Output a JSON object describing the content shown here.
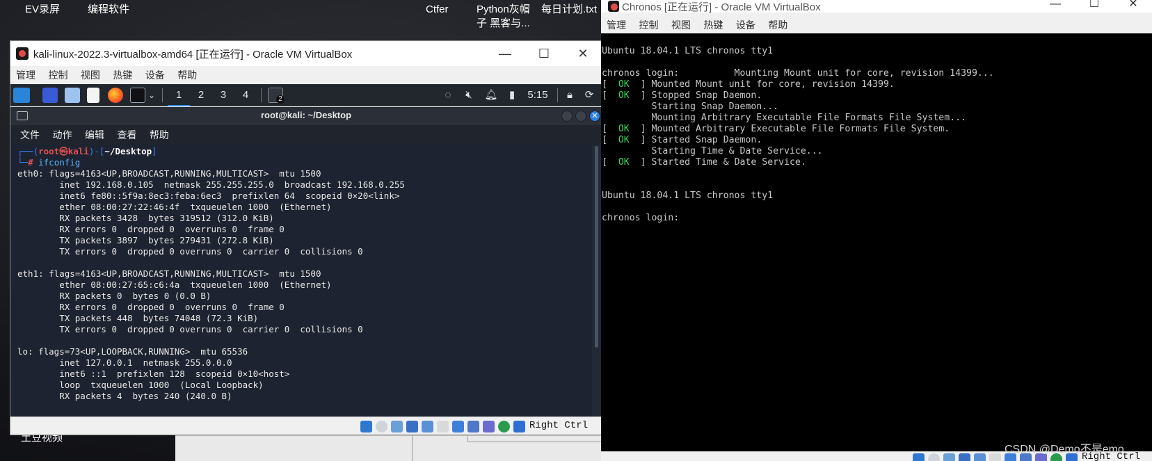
{
  "desktop": {
    "icons": [
      {
        "label": "EV录屏"
      },
      {
        "label": "编程软件"
      },
      {
        "label": "Ctfer"
      },
      {
        "label": "Python灰帽"
      },
      {
        "label": "子 黑客与..."
      },
      {
        "label": "每日计划.txt"
      },
      {
        "label": "土豆视频"
      }
    ],
    "watermark": "CSDN @Demo不是emo"
  },
  "kali_window": {
    "title": "kali-linux-2022.3-virtualbox-amd64 [正在运行] - Oracle VM VirtualBox",
    "menu": [
      "管理",
      "控制",
      "视图",
      "热键",
      "设备",
      "帮助"
    ],
    "panel": {
      "workspaces": [
        "1",
        "2",
        "3",
        "4"
      ],
      "terminal_badge": "2",
      "clock": "5:15"
    },
    "terminal": {
      "title": "root@kali: ~/Desktop",
      "menu": [
        "文件",
        "动作",
        "编辑",
        "查看",
        "帮助"
      ],
      "prompt": {
        "open": "┌──(",
        "user_host": "root㉿kali",
        "mid": ")-[",
        "path": "~/Desktop",
        "close": "]",
        "prefix": "└─",
        "hash": "# ",
        "command": "ifconfig"
      },
      "output": [
        "eth0: flags=4163<UP,BROADCAST,RUNNING,MULTICAST>  mtu 1500",
        "        inet 192.168.0.105  netmask 255.255.255.0  broadcast 192.168.0.255",
        "        inet6 fe80::5f9a:8ec3:feba:6ec3  prefixlen 64  scopeid 0×20<link>",
        "        ether 08:00:27:22:46:4f  txqueuelen 1000  (Ethernet)",
        "        RX packets 3428  bytes 319512 (312.0 KiB)",
        "        RX errors 0  dropped 0  overruns 0  frame 0",
        "        TX packets 3897  bytes 279431 (272.8 KiB)",
        "        TX errors 0  dropped 0 overruns 0  carrier 0  collisions 0",
        "",
        "eth1: flags=4163<UP,BROADCAST,RUNNING,MULTICAST>  mtu 1500",
        "        ether 08:00:27:65:c6:4a  txqueuelen 1000  (Ethernet)",
        "        RX packets 0  bytes 0 (0.0 B)",
        "        RX errors 0  dropped 0  overruns 0  frame 0",
        "        TX packets 448  bytes 74048 (72.3 KiB)",
        "        TX errors 0  dropped 0 overruns 0  carrier 0  collisions 0",
        "",
        "lo: flags=73<UP,LOOPBACK,RUNNING>  mtu 65536",
        "        inet 127.0.0.1  netmask 255.0.0.0",
        "        inet6 ::1  prefixlen 128  scopeid 0×10<host>",
        "        loop  txqueuelen 1000  (Local Loopback)",
        "        RX packets 4  bytes 240 (240.0 B)"
      ]
    },
    "status_host_key": "Right Ctrl"
  },
  "chronos_window": {
    "title": "Chronos [正在运行] - Oracle VM VirtualBox",
    "menu": [
      "管理",
      "控制",
      "视图",
      "热键",
      "设备",
      "帮助"
    ],
    "console": [
      {
        "text": "Ubuntu 18.04.1 LTS chronos tty1"
      },
      {
        "text": ""
      },
      {
        "text": "chronos login:          Mounting Mount unit for core, revision 14399..."
      },
      {
        "ok": true,
        "text": "Mounted Mount unit for core, revision 14399."
      },
      {
        "ok": true,
        "text": "Stopped Snap Daemon."
      },
      {
        "text": "         Starting Snap Daemon..."
      },
      {
        "text": "         Mounting Arbitrary Executable File Formats File System..."
      },
      {
        "ok": true,
        "text": "Mounted Arbitrary Executable File Formats File System."
      },
      {
        "ok": true,
        "text": "Started Snap Daemon."
      },
      {
        "text": "         Starting Time & Date Service..."
      },
      {
        "ok": true,
        "text": "Started Time & Date Service."
      },
      {
        "text": ""
      },
      {
        "text": ""
      },
      {
        "text": "Ubuntu 18.04.1 LTS chronos tty1"
      },
      {
        "text": ""
      },
      {
        "text": "chronos login:"
      }
    ],
    "ok_label": "OK",
    "status_host_key": "Right Ctrl"
  }
}
